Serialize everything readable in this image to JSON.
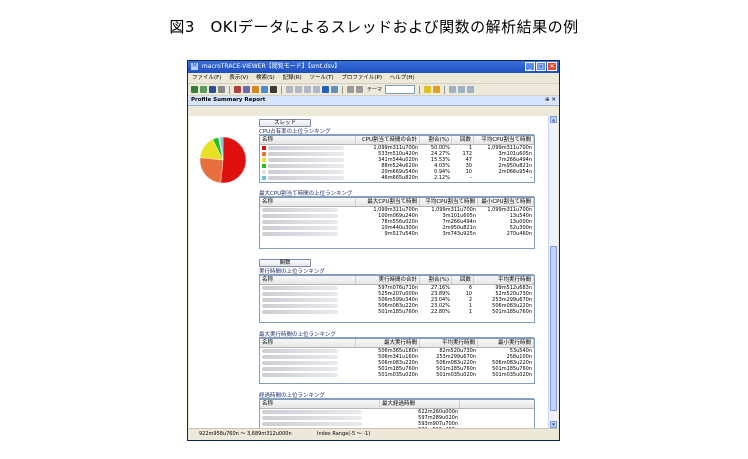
{
  "figure_caption": "図3　OKIデータによるスレッドおよび関数の解析結果の例",
  "window": {
    "title": "macroTRACE-VIEWER【閲覧モード】【smt.dsv】",
    "menu": [
      "ファイル(F)",
      "表示(V)",
      "検索(S)",
      "記録(R)",
      "ツール(T)",
      "プロファイル(P)",
      "ヘルプ(H)"
    ],
    "theme_label": "テーマ",
    "panel_title": "Profile Summary Report",
    "panel_controls": "⊕ ✕"
  },
  "thread_section": {
    "button": "スレッド",
    "cpu_title": "CPU占有率の上位ランキング",
    "cpu_headers": [
      "名称",
      "CPU割当て時間の合計",
      "割合(%)",
      "回数",
      "平均CPU割当て時間"
    ],
    "cpu_rows": [
      {
        "total": "1,099m311u700n",
        "pct": "50.00%",
        "count": "1",
        "avg": "1,099m311u700n",
        "color": "#e01010"
      },
      {
        "total": "533m510u420n",
        "pct": "24.27%",
        "count": "172",
        "avg": "3m101u605n",
        "color": "#e87040"
      },
      {
        "total": "341m544u020n",
        "pct": "15.53%",
        "count": "47",
        "avg": "7m266u494n",
        "color": "#e8e020"
      },
      {
        "total": "88m524u620n",
        "pct": "4.03%",
        "count": "30",
        "avg": "2m950u821n",
        "color": "#20c020"
      },
      {
        "total": "20m669u540n",
        "pct": "0.94%",
        "count": "10",
        "avg": "2m066u954n",
        "color": "#e0e0e0"
      },
      {
        "total": "46m665u820n",
        "pct": "2.12%",
        "count": "-",
        "avg": "-",
        "color": "#70c0e0"
      }
    ],
    "max_title": "最大CPU割当て時間の上位ランキング",
    "max_headers": [
      "名称",
      "最大CPU割当て時間",
      "平均CPU割当て時間",
      "最小CPU割当て時間"
    ],
    "max_rows": [
      {
        "max": "1,099m311u700n",
        "avg": "1,099m311u700n",
        "min": "1,099m311u700n"
      },
      {
        "max": "100m069u240n",
        "avg": "3m101u605n",
        "min": "13u540n"
      },
      {
        "max": "78m556u020n",
        "avg": "7m266u494n",
        "min": "13u000n"
      },
      {
        "max": "10m440u300n",
        "avg": "2m950u821n",
        "min": "52u300n"
      },
      {
        "max": "9m517u540n",
        "avg": "3m743u925n",
        "min": "270u460n"
      }
    ]
  },
  "function_section": {
    "button": "関数",
    "exec_title": "実行時間の上位ランキング",
    "exec_headers": [
      "名称",
      "実行時間の合計",
      "割合(%)",
      "回数",
      "平均実行時間"
    ],
    "exec_rows": [
      {
        "total": "597m076u710n",
        "pct": "27.16%",
        "count": "6",
        "avg": "99m512u683n"
      },
      {
        "total": "525m207u000n",
        "pct": "23.89%",
        "count": "10",
        "avg": "52m520u730n"
      },
      {
        "total": "506m599u340n",
        "pct": "23.04%",
        "count": "2",
        "avg": "253m299u670n"
      },
      {
        "total": "506m083u220n",
        "pct": "23.02%",
        "count": "1",
        "avg": "506m083u220n"
      },
      {
        "total": "501m185u760n",
        "pct": "22.80%",
        "count": "1",
        "avg": "501m185u760n"
      }
    ],
    "maxexec_title": "最大実行時間の上位ランキング",
    "maxexec_headers": [
      "名称",
      "最大実行時間",
      "平均実行時間",
      "最小実行時間"
    ],
    "maxexec_rows": [
      {
        "max": "506m365u180n",
        "avg": "82m520u730n",
        "min": "53u540n"
      },
      {
        "max": "506m341u160n",
        "avg": "253m299u670n",
        "min": "258u100n"
      },
      {
        "max": "506m083u220n",
        "avg": "506m083u220n",
        "min": "506m083u220n"
      },
      {
        "max": "501m185u760n",
        "avg": "501m185u760n",
        "min": "501m185u760n"
      },
      {
        "max": "501m035u020n",
        "avg": "501m035u020n",
        "min": "501m035u020n"
      }
    ],
    "elapsed_title": "経過時間の上位ランキング",
    "elapsed_headers": [
      "名称",
      "最大経過時間"
    ],
    "elapsed_rows": [
      {
        "max": "622m260u000n"
      },
      {
        "max": "597m289u020n"
      },
      {
        "max": "593m907u700n"
      },
      {
        "max": "581m515u430n"
      }
    ]
  },
  "status_bar": {
    "time": "922m958u760n ～ 3,689m312u000n",
    "range": "Index Range(-5 ～ -1)"
  },
  "colors": {
    "title_bar": "#1d4fc0",
    "panel_header": "#d6e4ff"
  }
}
